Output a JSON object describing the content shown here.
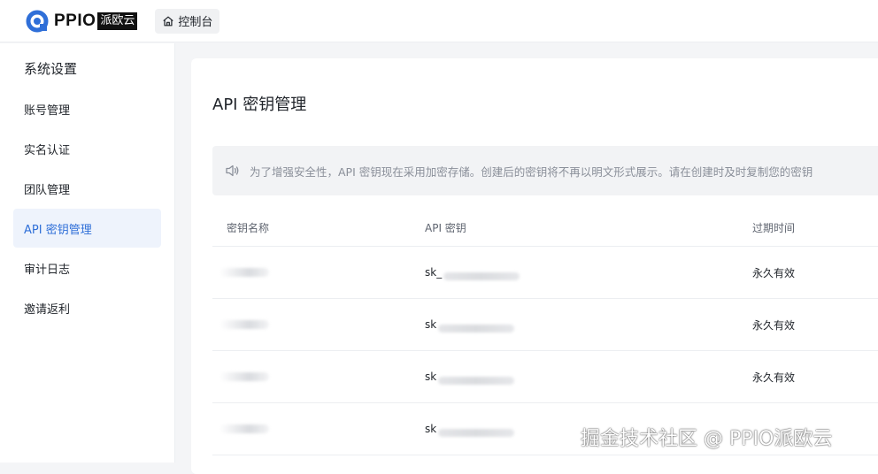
{
  "header": {
    "logo_text": "PPIO",
    "logo_badge": "派欧云",
    "console_label": "控制台"
  },
  "sidebar": {
    "title": "系统设置",
    "items": [
      {
        "label": "账号管理"
      },
      {
        "label": "实名认证"
      },
      {
        "label": "团队管理"
      },
      {
        "label": "API 密钥管理"
      },
      {
        "label": "审计日志"
      },
      {
        "label": "邀请返利"
      }
    ],
    "active_index": 3
  },
  "main": {
    "title": "API 密钥管理",
    "notice": "为了增强安全性，API 密钥现在采用加密存储。创建后的密钥将不再以明文形式展示。请在创建时及时复制您的密钥"
  },
  "table": {
    "columns": [
      "密钥名称",
      "API 密钥",
      "过期时间"
    ],
    "rows": [
      {
        "key_prefix": "sk_",
        "expiry": "永久有效"
      },
      {
        "key_prefix": "sk",
        "expiry": "永久有效"
      },
      {
        "key_prefix": "sk",
        "expiry": "永久有效"
      },
      {
        "key_prefix": "sk",
        "expiry": ""
      }
    ]
  },
  "watermark": "掘金技术社区 @ PPIO派欧云",
  "colors": {
    "accent": "#2f6fd8",
    "active_bg": "#eef3fc",
    "page_bg": "#f4f5f7"
  },
  "icons": {
    "logo": "ppio-logo-icon",
    "console": "home-icon",
    "notice": "speaker-icon"
  }
}
